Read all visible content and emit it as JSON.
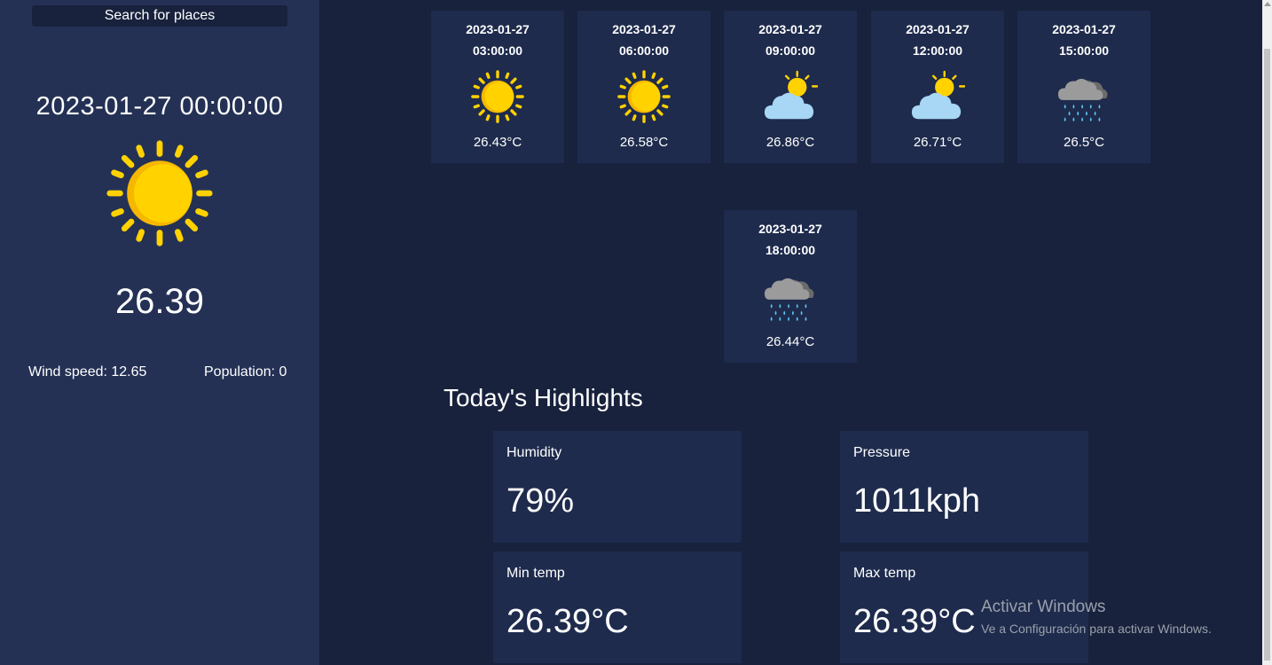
{
  "sidebar": {
    "search_label": "Search for places",
    "current_datetime": "2023-01-27 00:00:00",
    "current_icon": "sun-icon",
    "current_temp": "26.39",
    "wind_speed": "Wind speed: 12.65",
    "population": "Population: 0"
  },
  "forecast": [
    {
      "date": "2023-01-27",
      "time": "03:00:00",
      "temp": "26.43°C",
      "icon": "sun-icon"
    },
    {
      "date": "2023-01-27",
      "time": "06:00:00",
      "temp": "26.58°C",
      "icon": "sun-icon"
    },
    {
      "date": "2023-01-27",
      "time": "09:00:00",
      "temp": "26.86°C",
      "icon": "partly-cloudy-icon"
    },
    {
      "date": "2023-01-27",
      "time": "12:00:00",
      "temp": "26.71°C",
      "icon": "partly-cloudy-icon"
    },
    {
      "date": "2023-01-27",
      "time": "15:00:00",
      "temp": "26.5°C",
      "icon": "rain-cloud-icon"
    },
    {
      "date": "2023-01-27",
      "time": "18:00:00",
      "temp": "26.44°C",
      "icon": "rain-cloud-icon"
    }
  ],
  "highlights": {
    "title": "Today's Highlights",
    "humidity_label": "Humidity",
    "humidity_value": "79%",
    "pressure_label": "Pressure",
    "pressure_value": "1011kph",
    "min_label": "Min temp",
    "min_value": "26.39°C",
    "max_label": "Max temp",
    "max_value": "26.39°C"
  },
  "watermark": {
    "line1": "Activar Windows",
    "line2": "Ve a Configuración para activar Windows."
  },
  "colors": {
    "background": "#18223d",
    "sidebar": "#243155",
    "card": "#1e2b4d",
    "sun": "#ffd200",
    "cloud": "#a8d6f5",
    "rain": "#5cc6f0"
  }
}
